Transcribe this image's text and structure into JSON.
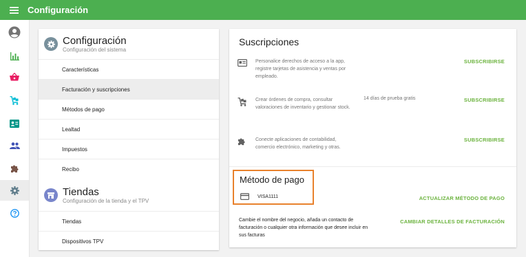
{
  "app": {
    "title": "Configuración"
  },
  "icons": {
    "menu": "menu-icon",
    "account": "account-circle-icon",
    "reports": "bar-chart-icon",
    "sales": "basket-icon",
    "inventory": "inventory-cart-icon",
    "customers": "id-card-icon",
    "employees": "people-icon",
    "integrations": "puzzle-icon",
    "settings": "gear-icon",
    "help": "help-circle-icon"
  },
  "colors": {
    "accent": "#4caf50",
    "link": "#6cb33f",
    "highlight": "#e8812c"
  },
  "settings_section": {
    "title": "Configuración",
    "subtitle": "Configuración del sistema",
    "items": [
      {
        "label": "Características"
      },
      {
        "label": "Facturación y suscripciones"
      },
      {
        "label": "Métodos de pago"
      },
      {
        "label": "Lealtad"
      },
      {
        "label": "Impuestos"
      },
      {
        "label": "Recibo"
      }
    ]
  },
  "stores_section": {
    "title": "Tiendas",
    "subtitle": "Configuración de la tienda y el TPV",
    "items": [
      {
        "label": "Tiendas"
      },
      {
        "label": "Dispositivos TPV"
      }
    ]
  },
  "subscriptions": {
    "title": "Suscripciones",
    "rows": [
      {
        "description": "Personalice derechos de acceso a la app, registre tarjetas de asistencia y ventas por empleado.",
        "trial": "",
        "action": "SUBSCRIBIRSE"
      },
      {
        "description": "Crear órdenes de compra, consultar valoraciones de inventario y gestionar stock.",
        "trial": "14 días de prueba gratis",
        "action": "SUBSCRIBIRSE"
      },
      {
        "description": "Conecte aplicaciones de contabilidad, comercio electrónico, marketing y otras.",
        "trial": "",
        "action": "SUBSCRIBIRSE"
      }
    ]
  },
  "payment_method": {
    "title": "Método de pago",
    "card_label": "VISA1111",
    "update_action": "ACTUALIZAR MÉTODO DE PAGO"
  },
  "billing": {
    "description": "Cambie el nombre del negocio, añada un contacto de facturación o cualquier otra información que desee incluir en sus facturas",
    "action": "CAMBIAR DETALLES DE FACTURACIÓN"
  }
}
